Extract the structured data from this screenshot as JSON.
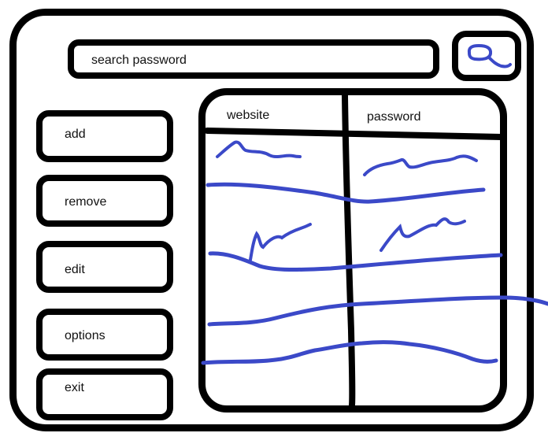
{
  "search": {
    "placeholder": "search password"
  },
  "sidebar": {
    "buttons": [
      {
        "label": "add"
      },
      {
        "label": "remove"
      },
      {
        "label": "edit"
      },
      {
        "label": "options"
      },
      {
        "label": "exit"
      }
    ]
  },
  "table": {
    "columns": [
      "website",
      "password"
    ],
    "row_count": 4
  },
  "colors": {
    "frame": "#000000",
    "scribble": "#3b49c8",
    "background": "#ffffff"
  },
  "icons": {
    "search_button": "search-icon"
  }
}
